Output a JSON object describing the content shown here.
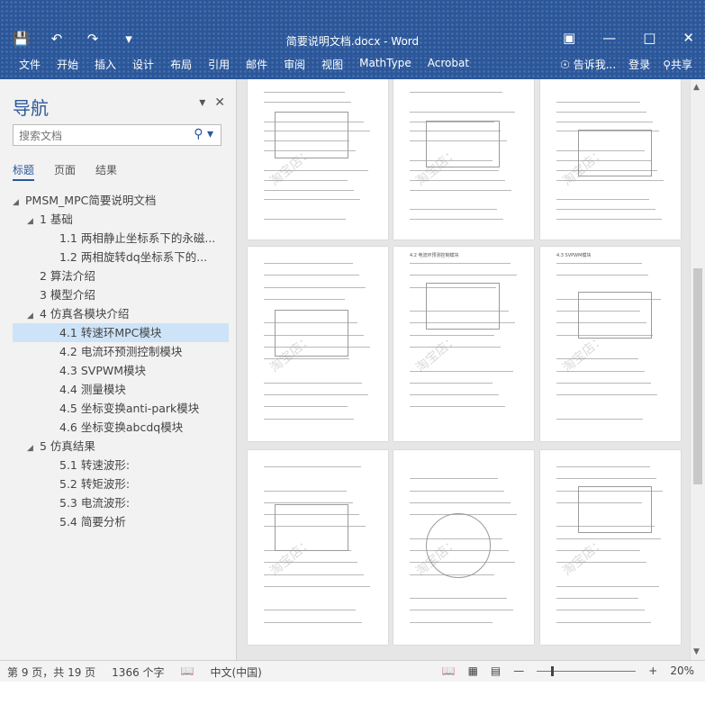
{
  "app": {
    "window_title": "简要说明文档.docx - Word",
    "qat": {
      "save_icon": "save-icon",
      "undo_icon": "undo-icon",
      "redo_icon": "redo-icon",
      "customize_icon": "customize-icon"
    },
    "window_controls": {
      "ribbon_display": "ribbon-display-icon",
      "minimize": "minimize-icon",
      "restore": "restore-icon",
      "close": "close-icon"
    }
  },
  "ribbon": {
    "tabs": [
      "文件",
      "开始",
      "插入",
      "设计",
      "布局",
      "引用",
      "邮件",
      "审阅",
      "视图",
      "MathType",
      "Acrobat"
    ],
    "tell_me": "告诉我...",
    "login": "登录",
    "share": "共享"
  },
  "nav_pane": {
    "title": "导航",
    "search_placeholder": "搜索文档",
    "tabs": [
      "标题",
      "页面",
      "结果"
    ],
    "tree": [
      {
        "level": 0,
        "toggle": "◢",
        "label": "PMSM_MPC简要说明文档"
      },
      {
        "level": 1,
        "toggle": "◢",
        "label": "1 基础"
      },
      {
        "level": 2,
        "toggle": "",
        "label": "1.1 两相静止坐标系下的永磁..."
      },
      {
        "level": 2,
        "toggle": "",
        "label": "1.2 两相旋转dq坐标系下的..."
      },
      {
        "level": 1,
        "toggle": "",
        "label": "2 算法介绍"
      },
      {
        "level": 1,
        "toggle": "",
        "label": "3 模型介绍"
      },
      {
        "level": 1,
        "toggle": "◢",
        "label": "4 仿真各模块介绍"
      },
      {
        "level": 2,
        "toggle": "",
        "label": "4.1 转速环MPC模块",
        "selected": true
      },
      {
        "level": 2,
        "toggle": "",
        "label": "4.2 电流环预测控制模块"
      },
      {
        "level": 2,
        "toggle": "",
        "label": "4.3 SVPWM模块"
      },
      {
        "level": 2,
        "toggle": "",
        "label": "4.4 测量模块"
      },
      {
        "level": 2,
        "toggle": "",
        "label": "4.5 坐标变换anti-park模块"
      },
      {
        "level": 2,
        "toggle": "",
        "label": "4.6 坐标变换abcdq模块"
      },
      {
        "level": 1,
        "toggle": "◢",
        "label": "5 仿真结果"
      },
      {
        "level": 2,
        "toggle": "",
        "label": "5.1 转速波形:"
      },
      {
        "level": 2,
        "toggle": "",
        "label": "5.2 转矩波形:"
      },
      {
        "level": 2,
        "toggle": "",
        "label": "5.3 电流波形:"
      },
      {
        "level": 2,
        "toggle": "",
        "label": "5.4 简要分析"
      }
    ]
  },
  "status_bar": {
    "page": "第 9 页，共 19 页",
    "words": "1366 个字",
    "lang": "中文(中国)",
    "zoom": "20%"
  },
  "document": {
    "watermark": "淘宝店：",
    "page_headings": [
      "4.2 电流环预测控制模块",
      "4.3 SVPWM模块"
    ]
  }
}
